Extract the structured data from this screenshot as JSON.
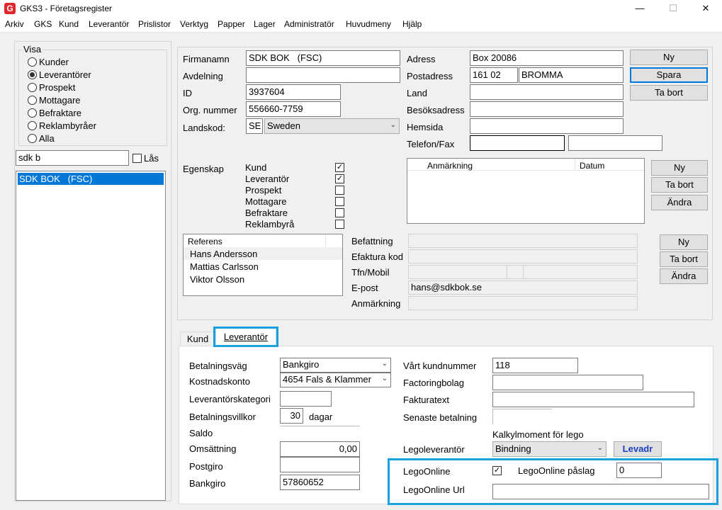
{
  "window": {
    "app_icon": "G",
    "title": "GKS3 - Företagsregister",
    "minimize": "—",
    "maximize": "☐",
    "close": "✕"
  },
  "menu": [
    "Arkiv",
    "GKS",
    "Kund",
    "Leverantör",
    "Prislistor",
    "Verktyg",
    "Papper",
    "Lager",
    "Administratör",
    "Huvudmeny",
    "Hjälp"
  ],
  "visa": {
    "title": "Visa",
    "options": [
      "Kunder",
      "Leverantörer",
      "Prospekt",
      "Mottagare",
      "Befraktare",
      "Reklambyråer",
      "Alla"
    ],
    "selected_index": 1
  },
  "search": {
    "value": "sdk b",
    "lock_label": "Lås"
  },
  "company_list": [
    "SDK BOK   (FSC)"
  ],
  "form": {
    "firmanamn_label": "Firmanamn",
    "firmanamn": "SDK BOK   (FSC)",
    "avdelning_label": "Avdelning",
    "avdelning": "",
    "id_label": "ID",
    "id": "3937604",
    "org_label": "Org. nummer",
    "org": "556660-7759",
    "landskod_label": "Landskod:",
    "landskod": "SE",
    "country": "Sweden",
    "adress_label": "Adress",
    "adress": "Box 20086",
    "postadress_label": "Postadress",
    "postnr": "161 02",
    "ort": "BROMMA",
    "land_label": "Land",
    "land": "",
    "besok_label": "Besöksadress",
    "besok": "",
    "hemsida_label": "Hemsida",
    "hemsida": "",
    "telefon_label": "Telefon/Fax",
    "telefon": "",
    "fax": ""
  },
  "buttons_main": {
    "ny": "Ny",
    "spara": "Spara",
    "ta_bort": "Ta bort"
  },
  "egenskap": {
    "label": "Egenskap",
    "items": [
      {
        "label": "Kund",
        "checked": true
      },
      {
        "label": "Leverantör",
        "checked": true
      },
      {
        "label": "Prospekt",
        "checked": false
      },
      {
        "label": "Mottagare",
        "checked": false
      },
      {
        "label": "Befraktare",
        "checked": false
      },
      {
        "label": "Reklambyrå",
        "checked": false
      }
    ]
  },
  "notes": {
    "col1": "Anmärkning",
    "col2": "Datum",
    "ny": "Ny",
    "ta_bort": "Ta bort",
    "andra": "Ändra"
  },
  "referens": {
    "header": "Referens",
    "rows": [
      "Hans Andersson",
      "Mattias Carlsson",
      "Viktor Olsson"
    ],
    "befattning_label": "Befattning",
    "befattning": "",
    "efaktura_label": "Efaktura kod",
    "efaktura": "",
    "tfn_label": "Tfn/Mobil",
    "tfn": "",
    "epost_label": "E-post",
    "epost": "hans@sdkbok.se",
    "anm_label": "Anmärkning",
    "anm": "",
    "ny": "Ny",
    "ta_bort": "Ta bort",
    "andra": "Ändra"
  },
  "tabs": [
    "Kund",
    "Leverantör"
  ],
  "leverantor": {
    "betalningsvag_label": "Betalningsväg",
    "betalningsvag": "Bankgiro",
    "kostnadskonto_label": "Kostnadskonto",
    "kostnadskonto": "4654 Fals & Klammer",
    "levkategori_label": "Leverantörskategori",
    "levkategori": "",
    "betvillkor_label": "Betalningsvillkor",
    "betvillkor": "30",
    "dagar_label": "dagar",
    "saldo_label": "Saldo",
    "saldo": "",
    "omsattning_label": "Omsättning",
    "omsattning": "0,00",
    "postgiro_label": "Postgiro",
    "postgiro": "",
    "bankgiro_label": "Bankgiro",
    "bankgiro": "57860652",
    "kundnummer_label": "Vårt kundnummer",
    "kundnummer": "118",
    "factoring_label": "Factoringbolag",
    "factoring": "",
    "fakturatext_label": "Fakturatext",
    "fakturatext": "",
    "senaste_label": "Senaste betalning",
    "senaste": "",
    "kalkyl_label": "Kalkylmoment för lego",
    "legolev_label": "Legoleverantör",
    "legolev": "Bindning",
    "levadr_button": "Levadr",
    "legoonline_label": "LegoOnline",
    "legoonline_checked": true,
    "paslag_label": "LegoOnline påslag",
    "paslag": "0",
    "url_label": "LegoOnline Url",
    "url": ""
  }
}
